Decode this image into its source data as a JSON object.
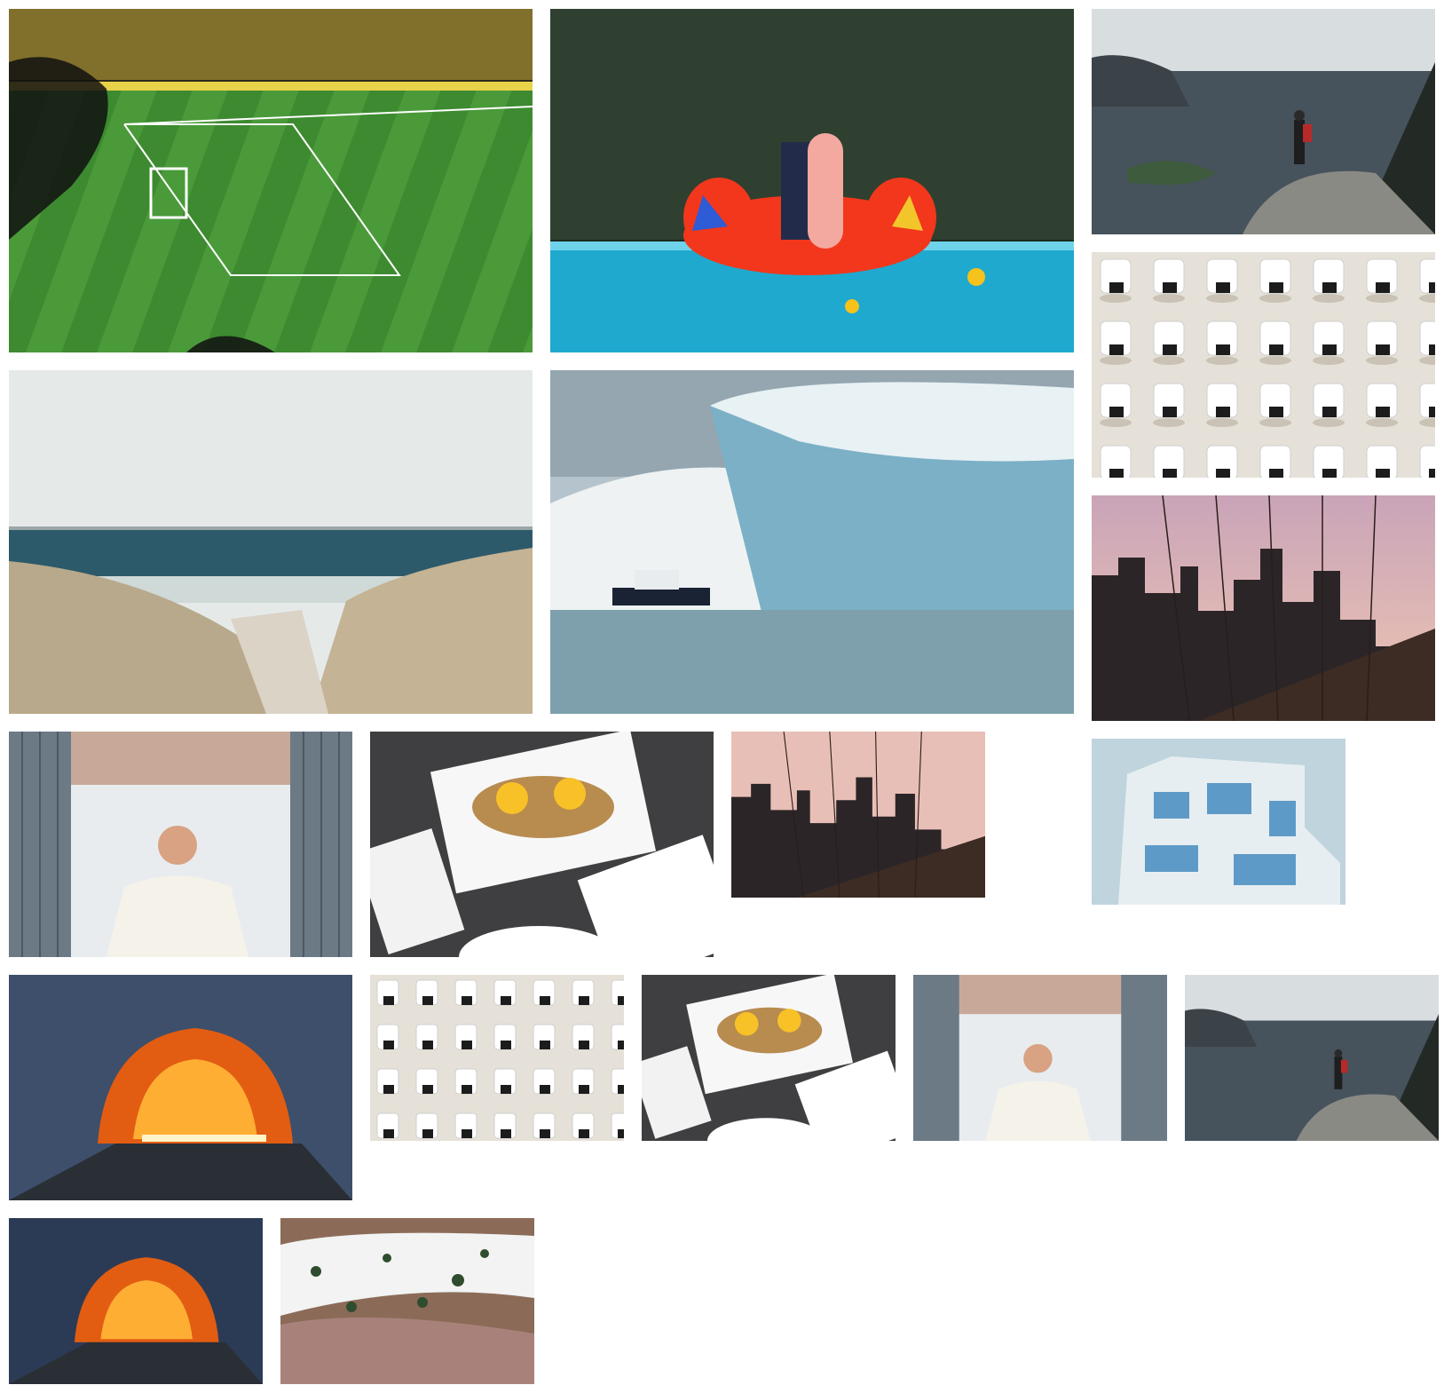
{
  "gallery": {
    "photos": [
      {
        "subject": "soccer-stadium"
      },
      {
        "subject": "pool-flamingo-float"
      },
      {
        "subject": "fjord-hiker"
      },
      {
        "subject": "beach-chairs-aerial"
      },
      {
        "subject": "beach-dunes"
      },
      {
        "subject": "iceberg-ship"
      },
      {
        "subject": "city-bridge-sunset"
      },
      {
        "subject": "man-in-container"
      },
      {
        "subject": "food-plates"
      },
      {
        "subject": "city-bridge-sunset"
      },
      {
        "subject": "blue-tower"
      },
      {
        "subject": "tunnel-glow"
      },
      {
        "subject": "beach-chairs-aerial"
      },
      {
        "subject": "food-plates"
      },
      {
        "subject": "man-in-container"
      },
      {
        "subject": "fjord-hiker"
      },
      {
        "subject": "tunnel-glow"
      },
      {
        "subject": "snowy-hills"
      }
    ]
  }
}
